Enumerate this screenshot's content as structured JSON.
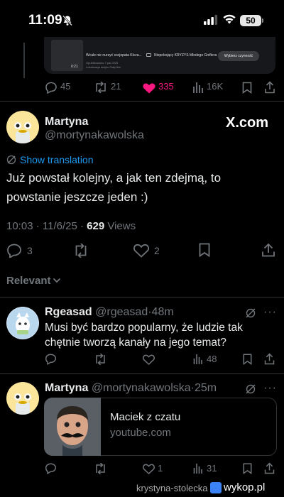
{
  "status_bar": {
    "time": "11:09",
    "battery": "50"
  },
  "quoted_card": {
    "thumb_time": "0:21",
    "title": "Wcale nie nurzyć socjopata Klcza...",
    "sub1": "Opublikowano 7 pai 2025",
    "sub2": "Lokalizacja miejsc Gały film",
    "story_label": "Niepokojący KRYZYS Młodego Gniftera",
    "button": "Wybierz czynność"
  },
  "prev_actions": {
    "replies": "45",
    "reposts": "21",
    "likes": "335",
    "views": "16K"
  },
  "main_post": {
    "name": "Martyna",
    "handle": "@mortynakawolska",
    "watermark": "X.com",
    "translate": "Show translation",
    "text": "Już powstał kolejny, a jak ten zdejmą, to powstanie jeszcze jeden :)",
    "time": "10:03 · 11/6/25 · ",
    "views_count": "629",
    "views_label": " Views",
    "replies": "3",
    "likes": "2"
  },
  "sort_label": "Relevant",
  "replies": [
    {
      "name": "Rgeasad",
      "handle": "@rgeasad",
      "time": "·48m",
      "text": "Musi być bardzo popularny, że ludzie tak chętnie tworzą kanały na jego temat?",
      "views": "48"
    },
    {
      "name": "Martyna",
      "handle": "@mortynakawolska",
      "time": "·25m",
      "card_title": "Maciek z czatu",
      "card_domain": "youtube.com",
      "likes": "1",
      "views": "31"
    }
  ],
  "footer": {
    "user": "krystyna-stolecka z",
    "site": "wykop.pl"
  },
  "colors": {
    "accent": "#1d9bf0",
    "like": "#f91880",
    "muted": "#71767b"
  }
}
